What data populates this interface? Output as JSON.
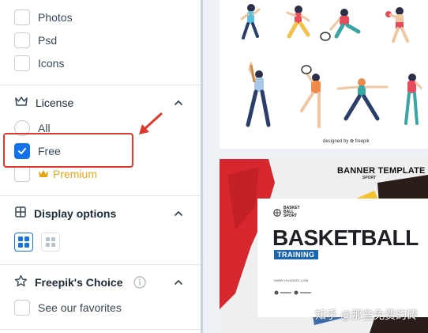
{
  "sidebar": {
    "file_types": [
      {
        "label": "Photos",
        "checked": false
      },
      {
        "label": "Psd",
        "checked": false
      },
      {
        "label": "Icons",
        "checked": false
      }
    ],
    "license": {
      "title": "License",
      "options": [
        {
          "label": "All",
          "type": "radio",
          "checked": false
        },
        {
          "label": "Free",
          "type": "checkbox",
          "checked": true
        },
        {
          "label": "Premium",
          "type": "checkbox",
          "checked": false,
          "icon": "crown-icon"
        }
      ]
    },
    "display_options": {
      "title": "Display options",
      "modes": [
        {
          "name": "grid-large",
          "active": true
        },
        {
          "name": "grid-small",
          "active": false
        }
      ]
    },
    "freepiks_choice": {
      "title": "Freepik's Choice",
      "option_label": "See our favorites"
    }
  },
  "content": {
    "card1": {
      "credit": "designed by ✿ freepik"
    },
    "card2": {
      "banner_title": "BANNER TEMPLATE",
      "banner_sub": "SPORT",
      "logo_text_1": "BASKET",
      "logo_text_2": "BALL",
      "logo_text_3": "SPORT",
      "headline": "BASKETBALL",
      "tag": "TRAINING",
      "url": "WWW.YOURSITE.COM"
    },
    "watermark": "知乎 @那些免费的砖"
  },
  "colors": {
    "accent": "#1273eb",
    "premium": "#e8a617",
    "annotation": "#e0392b"
  }
}
